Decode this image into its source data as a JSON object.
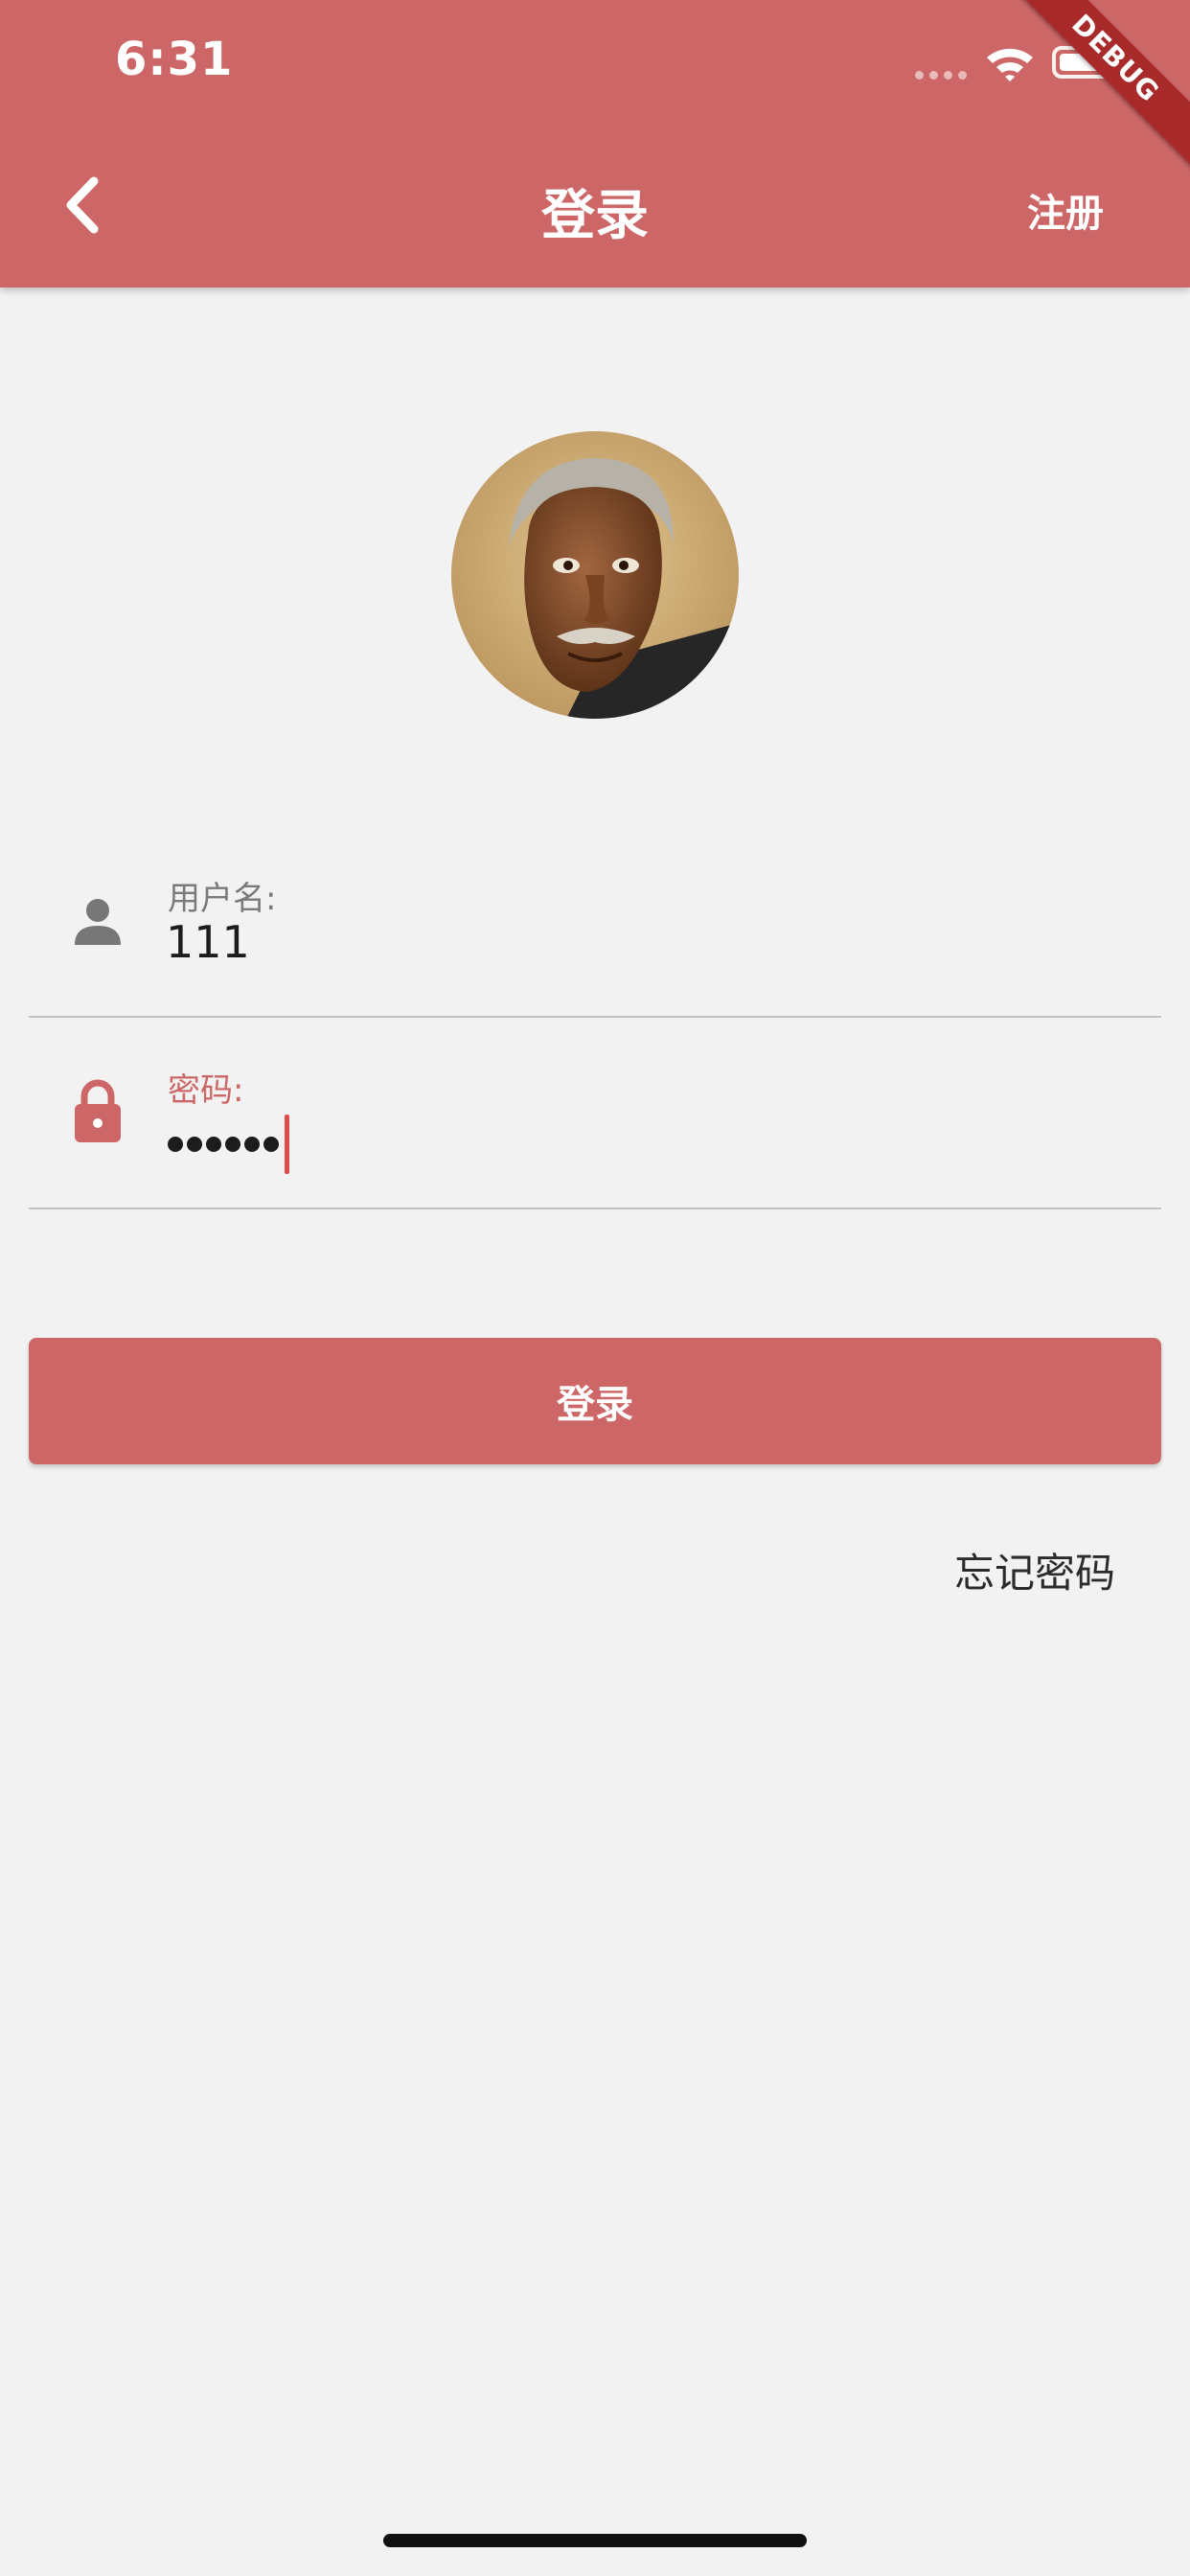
{
  "status_bar": {
    "time": "6:31"
  },
  "debug_banner": "DEBUG",
  "app_bar": {
    "title": "登录",
    "register_label": "注册",
    "back_icon": "chevron-left-icon",
    "color": "#cd6666"
  },
  "avatar": {
    "description_icon": "avatar-caricature"
  },
  "form": {
    "username": {
      "label": "用户名:",
      "value": "111",
      "icon": "person-icon"
    },
    "password": {
      "label": "密码:",
      "masked_length": 6,
      "icon": "lock-icon",
      "focused": true
    }
  },
  "login_button_label": "登录",
  "forgot_password_label": "忘记密码",
  "colors": {
    "accent": "#cd6666",
    "background": "#f2f2f2",
    "cursor": "#e04b4b"
  }
}
